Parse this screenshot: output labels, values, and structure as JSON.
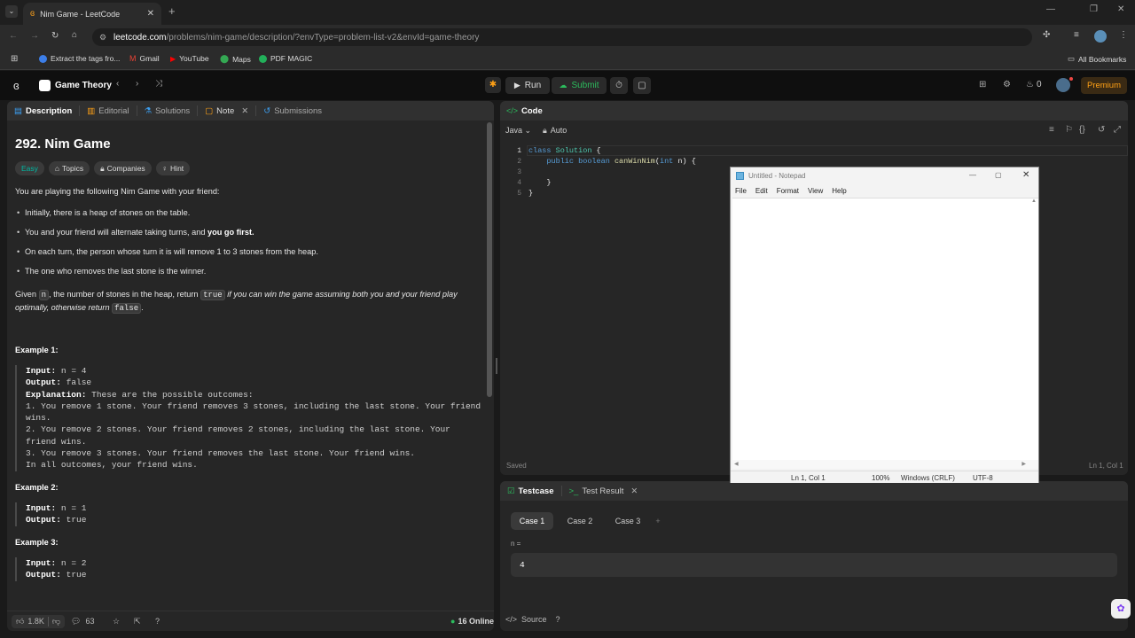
{
  "browser": {
    "tab_title": "Nim Game - LeetCode",
    "new_tab": "+",
    "url_domain": "leetcode.com",
    "url_path": "/problems/nim-game/description/?envType=problem-list-v2&envId=game-theory",
    "bookmarks": [
      "Extract the tags fro...",
      "Gmail",
      "YouTube",
      "Maps",
      "PDF MAGIC"
    ],
    "all_bookmarks": "All Bookmarks"
  },
  "topbar": {
    "list_name": "Game Theory",
    "run": "Run",
    "submit": "Submit",
    "streak": "0",
    "premium": "Premium"
  },
  "left": {
    "tabs": [
      "Description",
      "Editorial",
      "Solutions",
      "Note",
      "Submissions"
    ],
    "title": "292. Nim Game",
    "difficulty": "Easy",
    "chips": [
      "Topics",
      "Companies",
      "Hint"
    ],
    "intro": "You are playing the following Nim Game with your friend:",
    "bullets": [
      "Initially, there is a heap of stones on the table.",
      "You and your friend will alternate taking turns, and",
      "On each turn, the person whose turn it is will remove 1 to 3 stones from the heap.",
      "The one who removes the last stone is the winner."
    ],
    "bold_first": "you go first.",
    "given_a": "Given",
    "given_n": "n",
    "given_b": ", the number of stones in the heap, return",
    "given_true": "true",
    "given_c": "if you can win the game assuming both you and your friend play",
    "given_d": "optimally, otherwise return",
    "given_false": "false",
    "given_end": ".",
    "ex1_title": "Example 1:",
    "ex1_input_label": "Input:",
    "ex1_input": "n = 4",
    "ex1_output_label": "Output:",
    "ex1_output": "false",
    "ex1_expl_label": "Explanation:",
    "ex1_expl": "These are the possible outcomes:",
    "ex1_lines": [
      "1. You remove 1 stone. Your friend removes 3 stones, including the last stone. Your friend",
      "wins.",
      "2. You remove 2 stones. Your friend removes 2 stones, including the last stone. Your",
      "friend wins.",
      "3. You remove 3 stones. Your friend removes the last stone. Your friend wins.",
      "In all outcomes, your friend wins."
    ],
    "ex2_title": "Example 2:",
    "ex2_input": "n = 1",
    "ex2_output": "true",
    "ex3_title": "Example 3:",
    "ex3_input": "n = 2",
    "ex3_output": "true",
    "likes": "1.8K",
    "comments": "63",
    "online": "16 Online"
  },
  "code": {
    "header": "Code",
    "language": "Java",
    "mode": "Auto",
    "lines": [
      "class Solution {",
      "    public boolean canWinNim(int n) {",
      "        ",
      "    }",
      "}"
    ],
    "line_numbers": [
      "1",
      "2",
      "3",
      "4",
      "5"
    ],
    "saved": "Saved",
    "cursor": "Ln 1, Col 1"
  },
  "notepad": {
    "title": "Untitled - Notepad",
    "menu": [
      "File",
      "Edit",
      "Format",
      "View",
      "Help"
    ],
    "status_pos": "Ln 1, Col 1",
    "status_zoom": "100%",
    "status_eol": "Windows (CRLF)",
    "status_enc": "UTF-8"
  },
  "testpanel": {
    "tab_testcase": "Testcase",
    "tab_result": "Test Result",
    "cases": [
      "Case 1",
      "Case 2",
      "Case 3"
    ],
    "add": "+",
    "param_label": "n =",
    "param_value": "4",
    "source": "Source"
  },
  "colors": {
    "accent_green": "#2cbb5d",
    "premium": "#ffa116",
    "easy": "#00b8a3"
  }
}
